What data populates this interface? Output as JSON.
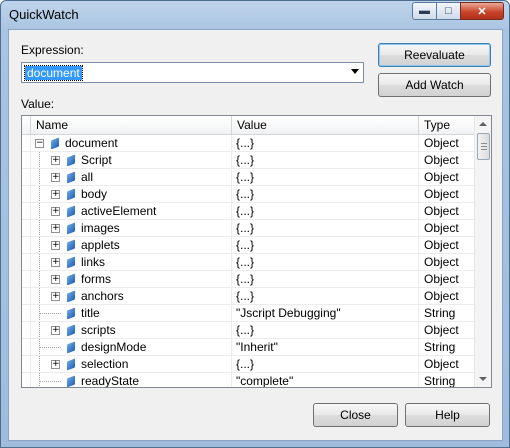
{
  "window": {
    "title": "QuickWatch"
  },
  "expression": {
    "label": "Expression:",
    "value": "document"
  },
  "buttons": {
    "reevaluate": "Reevaluate",
    "add_watch": "Add Watch",
    "close": "Close",
    "help": "Help"
  },
  "value_label": "Value:",
  "columns": {
    "name": "Name",
    "value": "Value",
    "type": "Type"
  },
  "rows": [
    {
      "name": "document",
      "value": "{...}",
      "type": "Object",
      "level": 0,
      "expander": "minus"
    },
    {
      "name": "Script",
      "value": "{...}",
      "type": "Object",
      "level": 1,
      "expander": "plus"
    },
    {
      "name": "all",
      "value": "{...}",
      "type": "Object",
      "level": 1,
      "expander": "plus"
    },
    {
      "name": "body",
      "value": "{...}",
      "type": "Object",
      "level": 1,
      "expander": "plus"
    },
    {
      "name": "activeElement",
      "value": "{...}",
      "type": "Object",
      "level": 1,
      "expander": "plus"
    },
    {
      "name": "images",
      "value": "{...}",
      "type": "Object",
      "level": 1,
      "expander": "plus"
    },
    {
      "name": "applets",
      "value": "{...}",
      "type": "Object",
      "level": 1,
      "expander": "plus"
    },
    {
      "name": "links",
      "value": "{...}",
      "type": "Object",
      "level": 1,
      "expander": "plus"
    },
    {
      "name": "forms",
      "value": "{...}",
      "type": "Object",
      "level": 1,
      "expander": "plus"
    },
    {
      "name": "anchors",
      "value": "{...}",
      "type": "Object",
      "level": 1,
      "expander": "plus"
    },
    {
      "name": "title",
      "value": "\"Jscript Debugging\"",
      "type": "String",
      "level": 1,
      "expander": "none"
    },
    {
      "name": "scripts",
      "value": "{...}",
      "type": "Object",
      "level": 1,
      "expander": "plus"
    },
    {
      "name": "designMode",
      "value": "\"Inherit\"",
      "type": "String",
      "level": 1,
      "expander": "none"
    },
    {
      "name": "selection",
      "value": "{...}",
      "type": "Object",
      "level": 1,
      "expander": "plus"
    },
    {
      "name": "readyState",
      "value": "\"complete\"",
      "type": "String",
      "level": 1,
      "expander": "none"
    }
  ]
}
